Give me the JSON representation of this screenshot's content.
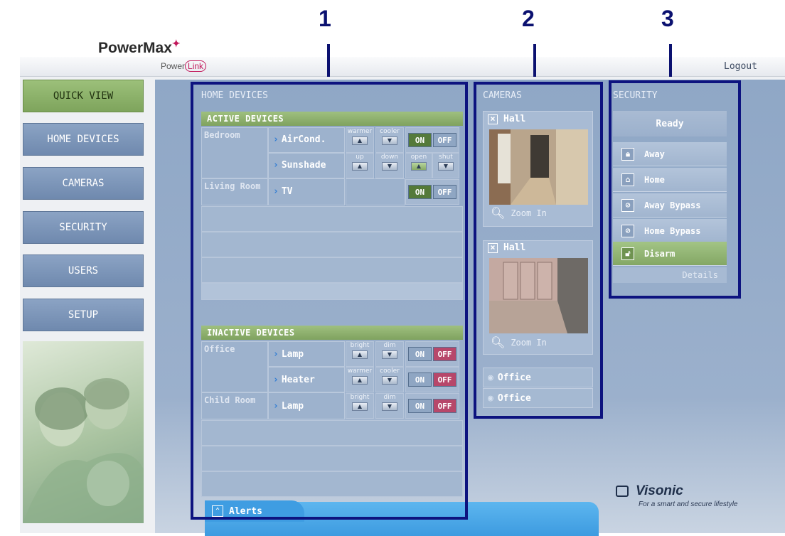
{
  "brand": {
    "powermax": "PowerMax",
    "powerlink_a": "Power",
    "powerlink_b": "Link"
  },
  "header": {
    "logout": "Logout"
  },
  "nav": [
    "QUICK VIEW",
    "HOME DEVICES",
    "CAMERAS",
    "SECURITY",
    "USERS",
    "SETUP"
  ],
  "markers": [
    "1",
    "2",
    "3"
  ],
  "home_devices": {
    "title": "HOME DEVICES",
    "active_title": "ACTIVE DEVICES",
    "inactive_title": "INACTIVE DEVICES",
    "active": [
      {
        "room": "Bedroom",
        "device": "AirCond.",
        "c1": "warmer",
        "c2": "cooler",
        "on": "ON",
        "off": "OFF"
      },
      {
        "device": "Sunshade",
        "c1": "up",
        "c2": "down",
        "c3": "open",
        "c4": "shut"
      },
      {
        "room": "Living Room",
        "device": "TV",
        "on": "ON",
        "off": "OFF"
      }
    ],
    "inactive": [
      {
        "room": "Office",
        "device": "Lamp",
        "c1": "bright",
        "c2": "dim",
        "on": "ON",
        "off": "OFF"
      },
      {
        "device": "Heater",
        "c1": "warmer",
        "c2": "cooler",
        "on": "ON",
        "off": "OFF"
      },
      {
        "room": "Child Room",
        "device": "Lamp",
        "c1": "bright",
        "c2": "dim",
        "on": "ON",
        "off": "OFF"
      }
    ],
    "alerts": "Alerts"
  },
  "cameras": {
    "title": "CAMERAS",
    "feeds": [
      {
        "name": "Hall",
        "zoom": "Zoom In"
      },
      {
        "name": "Hall",
        "zoom": "Zoom In"
      }
    ],
    "links": [
      "Office",
      "Office"
    ]
  },
  "security": {
    "title": "SECURITY",
    "status": "Ready",
    "buttons": [
      "Away",
      "Home",
      "Away Bypass",
      "Home Bypass",
      "Disarm"
    ],
    "details": "Details"
  },
  "footer": {
    "visonic": "Visonic",
    "tagline": "For a smart and secure lifestyle"
  },
  "colors": {
    "nav_active": "#8fb26d",
    "panel_bg": "#9bb0cc",
    "outline": "#0d137f",
    "off_red": "#b7476a"
  }
}
